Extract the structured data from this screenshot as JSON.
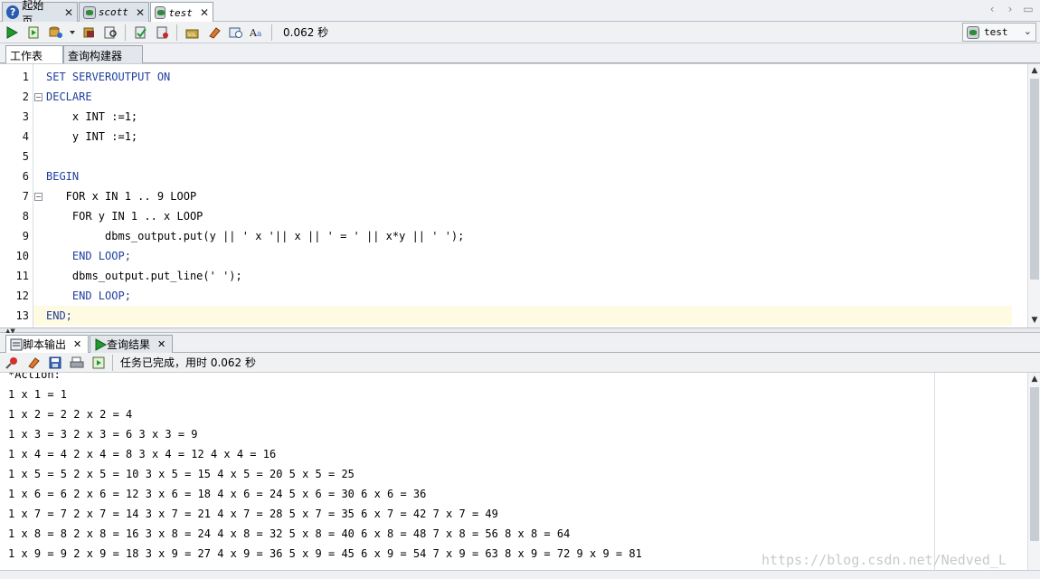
{
  "tabs": [
    {
      "label": "起始页",
      "icon": "help-icon"
    },
    {
      "label": "scott",
      "icon": "sql-worksheet-icon"
    },
    {
      "label": "test",
      "icon": "sql-worksheet-icon"
    }
  ],
  "toolbar": {
    "elapsed": "0.062 秒",
    "connection": "test"
  },
  "subtabs": [
    "工作表",
    "查询构建器"
  ],
  "editor": {
    "lines": [
      {
        "n": "1",
        "text": "SET SERVEROUTPUT ON"
      },
      {
        "n": "2",
        "text": "DECLARE"
      },
      {
        "n": "3",
        "text": "    x INT :=1;"
      },
      {
        "n": "4",
        "text": "    y INT :=1;"
      },
      {
        "n": "5",
        "text": ""
      },
      {
        "n": "6",
        "text": "BEGIN"
      },
      {
        "n": "7",
        "text": "   FOR x IN 1 .. 9 LOOP"
      },
      {
        "n": "8",
        "text": "    FOR y IN 1 .. x LOOP"
      },
      {
        "n": "9",
        "text": "         dbms_output.put(y || ' x '|| x || ' = ' || x*y || ' ');"
      },
      {
        "n": "10",
        "text": "    END LOOP;"
      },
      {
        "n": "11",
        "text": "    dbms_output.put_line(' ');"
      },
      {
        "n": "12",
        "text": "    END LOOP;"
      },
      {
        "n": "13",
        "text": "END;"
      }
    ]
  },
  "output_tabs": [
    {
      "label": "脚本输出",
      "icon": "script-output-icon"
    },
    {
      "label": "查询结果",
      "icon": "run-icon"
    }
  ],
  "output": {
    "status": "任务已完成，用时 0.062 秒",
    "lines": [
      "*Action:",
      "1 x 1 = 1",
      "1 x 2 = 2 2 x 2 = 4",
      "1 x 3 = 3 2 x 3 = 6 3 x 3 = 9",
      "1 x 4 = 4 2 x 4 = 8 3 x 4 = 12 4 x 4 = 16",
      "1 x 5 = 5 2 x 5 = 10 3 x 5 = 15 4 x 5 = 20 5 x 5 = 25",
      "1 x 6 = 6 2 x 6 = 12 3 x 6 = 18 4 x 6 = 24 5 x 6 = 30 6 x 6 = 36",
      "1 x 7 = 7 2 x 7 = 14 3 x 7 = 21 4 x 7 = 28 5 x 7 = 35 6 x 7 = 42 7 x 7 = 49",
      "1 x 8 = 8 2 x 8 = 16 3 x 8 = 24 4 x 8 = 32 5 x 8 = 40 6 x 8 = 48 7 x 8 = 56 8 x 8 = 64",
      "1 x 9 = 9 2 x 9 = 18 3 x 9 = 27 4 x 9 = 36 5 x 9 = 45 6 x 9 = 54 7 x 9 = 63 8 x 9 = 72 9 x 9 = 81"
    ],
    "watermark": "https://blog.csdn.net/Nedved_L"
  },
  "colors": {
    "keyword": "#1f3f9f",
    "number": "#2e8b3a",
    "current_line": "#fffbe3"
  }
}
